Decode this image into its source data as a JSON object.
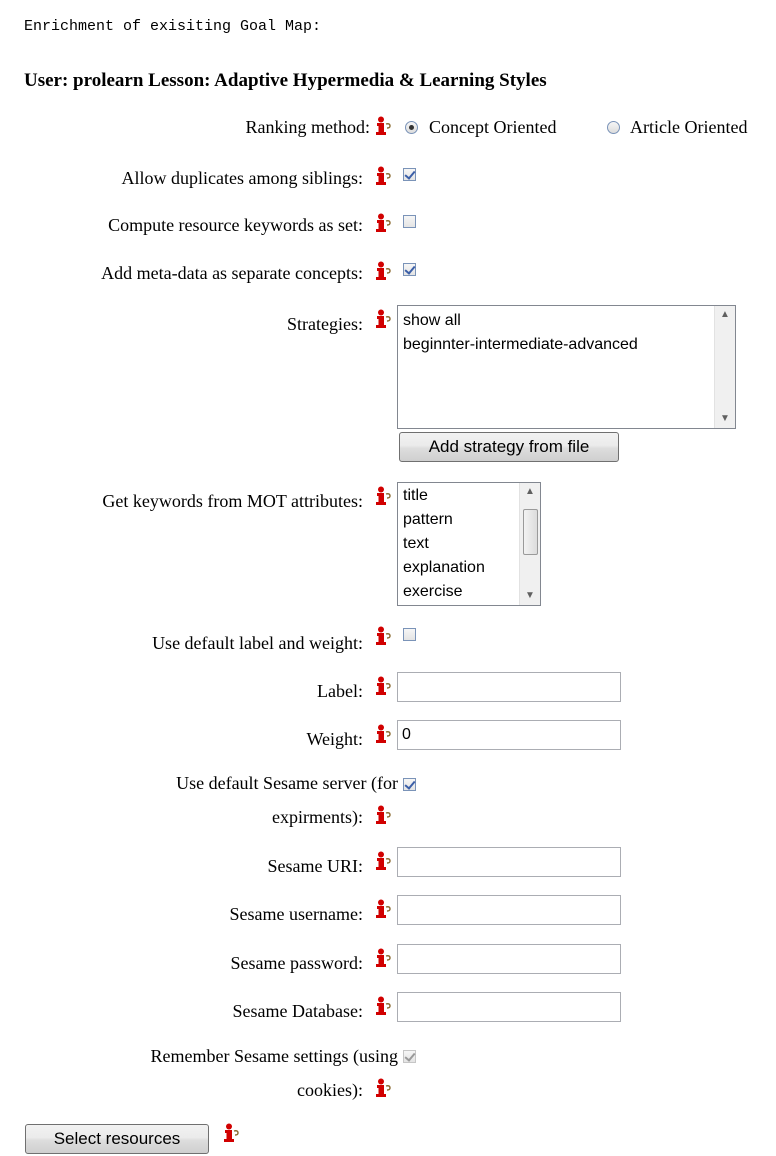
{
  "header": {
    "title": "Enrichment of exisiting Goal Map:",
    "subtitle": "User: prolearn Lesson: Adaptive Hypermedia & Learning Styles"
  },
  "colors": {
    "info_icon": "#cc0000",
    "accent_check": "#3b5fa8"
  },
  "icons": {
    "info": "info-icon"
  },
  "ranking": {
    "label": "Ranking method:",
    "options": [
      {
        "label": "Concept Oriented",
        "selected": true
      },
      {
        "label": "Article Oriented",
        "selected": false
      }
    ]
  },
  "allow_duplicates": {
    "label": "Allow duplicates among siblings:",
    "checked": true
  },
  "keywords_as_set": {
    "label": "Compute resource keywords as set:",
    "checked": false
  },
  "meta_data": {
    "label": "Add meta-data as separate concepts:",
    "checked": true
  },
  "strategies": {
    "label": "Strategies:",
    "items": [
      "show all",
      "beginnter-intermediate-advanced"
    ],
    "add_button": "Add strategy from file"
  },
  "mot_attributes": {
    "label": "Get keywords from MOT attributes:",
    "items": [
      "title",
      "pattern",
      "text",
      "explanation",
      "exercise"
    ]
  },
  "default_label_weight": {
    "label": "Use default label and weight:",
    "checked": false
  },
  "label_field": {
    "label": "Label:",
    "value": ""
  },
  "weight_field": {
    "label": "Weight:",
    "value": "0"
  },
  "default_sesame": {
    "label_line1": "Use default Sesame server (for",
    "label_line2": "expirments):",
    "checked": true
  },
  "sesame_uri": {
    "label": "Sesame URI:",
    "value": ""
  },
  "sesame_username": {
    "label": "Sesame username:",
    "value": ""
  },
  "sesame_password": {
    "label": "Sesame password:",
    "value": ""
  },
  "sesame_database": {
    "label": "Sesame Database:",
    "value": ""
  },
  "remember_sesame": {
    "label_line1": "Remember Sesame settings (using",
    "label_line2": "cookies):",
    "checked": true,
    "disabled": true
  },
  "select_button": "Select resources"
}
